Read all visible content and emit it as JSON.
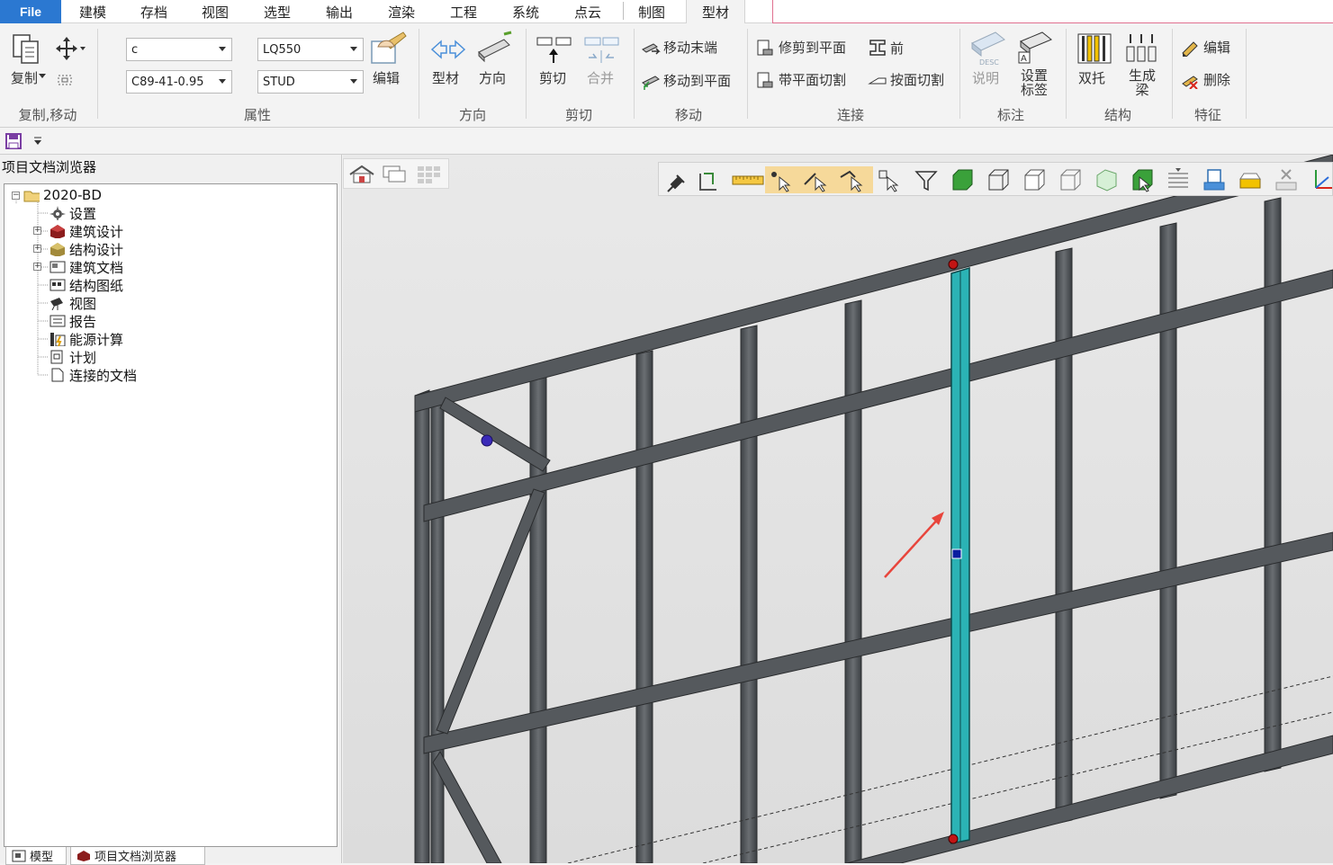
{
  "menu": {
    "file": "File",
    "tabs": [
      "建模",
      "存档",
      "视图",
      "选型",
      "输出",
      "渲染",
      "工程",
      "系统",
      "点云",
      "制图",
      "型材"
    ],
    "active_index": 10
  },
  "ribbon": {
    "groups": {
      "copy_move": {
        "label": "复制,移动",
        "copy": "复制"
      },
      "properties": {
        "label": "属性",
        "profile_type": "c",
        "profile_size": "C89-41-0.95",
        "material": "LQ550",
        "usage": "STUD",
        "edit": "编辑"
      },
      "direction": {
        "label": "方向",
        "profile": "型材",
        "direction": "方向"
      },
      "cut": {
        "label": "剪切",
        "cut": "剪切",
        "merge": "合并"
      },
      "move": {
        "label": "移动",
        "move_end": "移动末端",
        "move_to_plane": "移动到平面"
      },
      "connect": {
        "label": "连接",
        "trim_to_plane": "修剪到平面",
        "plane_cut": "带平面切割",
        "front": "前",
        "cut_by_face": "按面切割"
      },
      "annotate": {
        "label": "标注",
        "desc": "说明",
        "set_label": "设置标签",
        "desc_icon_text": "DESC",
        "label_icon_text": "A"
      },
      "structure": {
        "label": "结构",
        "double": "双托",
        "generate_beam": "生成梁"
      },
      "feature": {
        "label": "特征",
        "edit": "编辑",
        "delete": "删除"
      }
    }
  },
  "browser": {
    "title": "项目文档浏览器",
    "root": "2020-BD",
    "items": [
      {
        "label": "设置",
        "icon": "gear-icon",
        "expandable": false
      },
      {
        "label": "建筑设计",
        "icon": "architecture-icon",
        "expandable": true
      },
      {
        "label": "结构设计",
        "icon": "structure-box-icon",
        "expandable": true
      },
      {
        "label": "建筑文档",
        "icon": "document-icon",
        "expandable": true
      },
      {
        "label": "结构图纸",
        "icon": "drawing-icon",
        "expandable": false
      },
      {
        "label": "视图",
        "icon": "camera-icon",
        "expandable": false
      },
      {
        "label": "报告",
        "icon": "report-icon",
        "expandable": false
      },
      {
        "label": "能源计算",
        "icon": "energy-icon",
        "expandable": false
      },
      {
        "label": "计划",
        "icon": "plan-icon",
        "expandable": false
      },
      {
        "label": "连接的文档",
        "icon": "linked-doc-icon",
        "expandable": false
      }
    ],
    "bottom_tabs": [
      "模型",
      "项目文档浏览器"
    ]
  },
  "colors": {
    "accent": "#2b78d1",
    "selected_member": "#2bb3b5",
    "frame_member": "#5a5e62",
    "highlight_tool": "#f6d99a",
    "arrow": "#e8453c"
  }
}
